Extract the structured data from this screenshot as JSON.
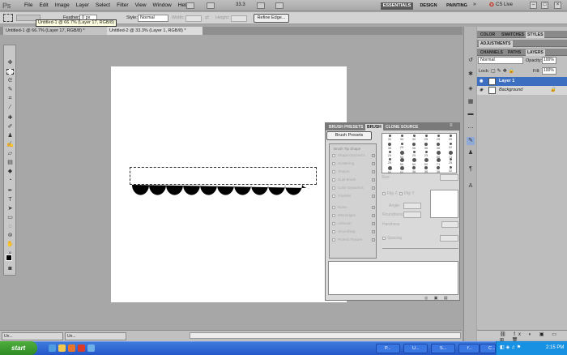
{
  "app": {
    "logo": "Ps",
    "menus": [
      "File",
      "Edit",
      "Image",
      "Layer",
      "Select",
      "Filter",
      "View",
      "Window",
      "Help"
    ],
    "zoom": "33.3",
    "workspaces": [
      "ESSENTIALS",
      "DESIGN",
      "PAINTING"
    ],
    "cslive": "CS Live"
  },
  "options": {
    "feather_label": "Feather:",
    "feather_value": "0 px",
    "style_label": "Style:",
    "style_value": "Normal",
    "width_label": "Width:",
    "height_label": "Height:",
    "refine_edge": "Refine Edge..."
  },
  "tooltip": "Untitled-1 @ 66.7% (Layer 17, RGB/8)",
  "documents": [
    {
      "label": "Untitled-1 @ 66.7% (Layer 17, RGB/8) *",
      "close": "×"
    },
    {
      "label": "Untitled-2 @ 33.3% (Layer 1, RGB/8) *",
      "close": "×"
    }
  ],
  "brush_panel": {
    "tabs": [
      "BRUSH PRESETS",
      "BRUSH",
      "CLONE SOURCE"
    ],
    "presets_button": "Brush Presets",
    "settings": [
      "Brush Tip Shape",
      "Shape Dynamics",
      "Scattering",
      "Texture",
      "Dual Brush",
      "Color Dynamics",
      "Transfer",
      "Noise",
      "Wet Edges",
      "Airbrush",
      "Smoothing",
      "Protect Texture"
    ],
    "tip_sizes": [
      "30",
      "30",
      "30",
      "25",
      "25",
      "25",
      "36",
      "25",
      "36",
      "36",
      "36",
      "32",
      "25",
      "50",
      "25",
      "25",
      "50",
      "71",
      "25",
      "50",
      "50",
      "50",
      "71",
      "25",
      "50",
      "50",
      "36",
      "36",
      "36",
      "32"
    ],
    "size_label": "Size",
    "flip_x": "Flip X",
    "flip_y": "Flip Y",
    "angle_label": "Angle:",
    "roundness_label": "Roundness:",
    "hardness_label": "Hardness",
    "spacing_label": "Spacing"
  },
  "right_panels": {
    "top_tabs": [
      "COLOR",
      "SWATCHES",
      "STYLES"
    ],
    "adjustments": "ADJUSTMENTS",
    "layer_tabs": [
      "CHANNELS",
      "PATHS",
      "LAYERS"
    ],
    "blend_mode": "Normal",
    "opacity_label": "Opacity:",
    "opacity": "100%",
    "lock_label": "Lock:",
    "fill_label": "Fill:",
    "fill": "100%",
    "layers": [
      {
        "name": "Layer 1",
        "selected": true
      },
      {
        "name": "Background",
        "selected": false
      }
    ]
  },
  "status": {
    "minimized": [
      "Un...",
      "Un..."
    ]
  },
  "taskbar": {
    "start": "start",
    "tasks": [
      "P...",
      "U...",
      "S...",
      "f...",
      "C..."
    ],
    "clock": "2:15 PM"
  }
}
